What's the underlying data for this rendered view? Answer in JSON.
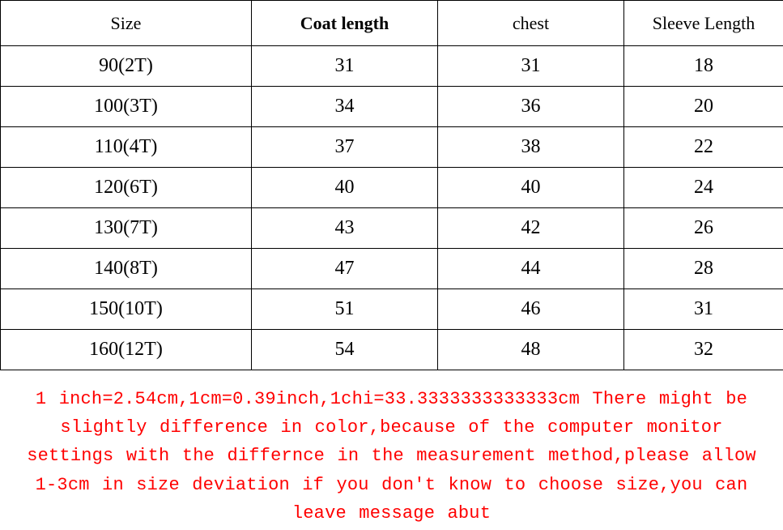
{
  "chart_data": {
    "type": "table",
    "headers": [
      "Size",
      "Coat length",
      "chest",
      "Sleeve Length"
    ],
    "rows": [
      {
        "size": "90(2T)",
        "coat_length": 31,
        "chest": 31,
        "sleeve_length": 18
      },
      {
        "size": "100(3T)",
        "coat_length": 34,
        "chest": 36,
        "sleeve_length": 20
      },
      {
        "size": "110(4T)",
        "coat_length": 37,
        "chest": 38,
        "sleeve_length": 22
      },
      {
        "size": "120(6T)",
        "coat_length": 40,
        "chest": 40,
        "sleeve_length": 24
      },
      {
        "size": "130(7T)",
        "coat_length": 43,
        "chest": 42,
        "sleeve_length": 26
      },
      {
        "size": "140(8T)",
        "coat_length": 47,
        "chest": 44,
        "sleeve_length": 28
      },
      {
        "size": "150(10T)",
        "coat_length": 51,
        "chest": 46,
        "sleeve_length": 31
      },
      {
        "size": "160(12T)",
        "coat_length": 54,
        "chest": 48,
        "sleeve_length": 32
      }
    ],
    "note": "1 inch=2.54cm,1cm=0.39inch,1chi=33.3333333333333cm There might be slightly difference in color,because of the computer monitor settings with the differnce in the measurement method,please allow 1-3cm in size deviation if you don't know to choose size,you can leave message abut"
  },
  "table": {
    "headers": {
      "size": "Size",
      "coat_length": "Coat length",
      "chest": "chest",
      "sleeve_length": "Sleeve Length"
    },
    "rows": [
      {
        "size": "90(2T)",
        "coat_length": "31",
        "chest": "31",
        "sleeve_length": "18"
      },
      {
        "size": "100(3T)",
        "coat_length": "34",
        "chest": "36",
        "sleeve_length": "20"
      },
      {
        "size": "110(4T)",
        "coat_length": "37",
        "chest": "38",
        "sleeve_length": "22"
      },
      {
        "size": "120(6T)",
        "coat_length": "40",
        "chest": "40",
        "sleeve_length": "24"
      },
      {
        "size": "130(7T)",
        "coat_length": "43",
        "chest": "42",
        "sleeve_length": "26"
      },
      {
        "size": "140(8T)",
        "coat_length": "47",
        "chest": "44",
        "sleeve_length": "28"
      },
      {
        "size": "150(10T)",
        "coat_length": "51",
        "chest": "46",
        "sleeve_length": "31"
      },
      {
        "size": "160(12T)",
        "coat_length": "54",
        "chest": "48",
        "sleeve_length": "32"
      }
    ]
  },
  "note": "1 inch=2.54cm,1cm=0.39inch,1chi=33.3333333333333cm There might be slightly difference in color,because of the computer monitor settings with the differnce in the measurement method,please allow 1-3cm in size deviation if you don't know to choose size,you can leave message abut"
}
